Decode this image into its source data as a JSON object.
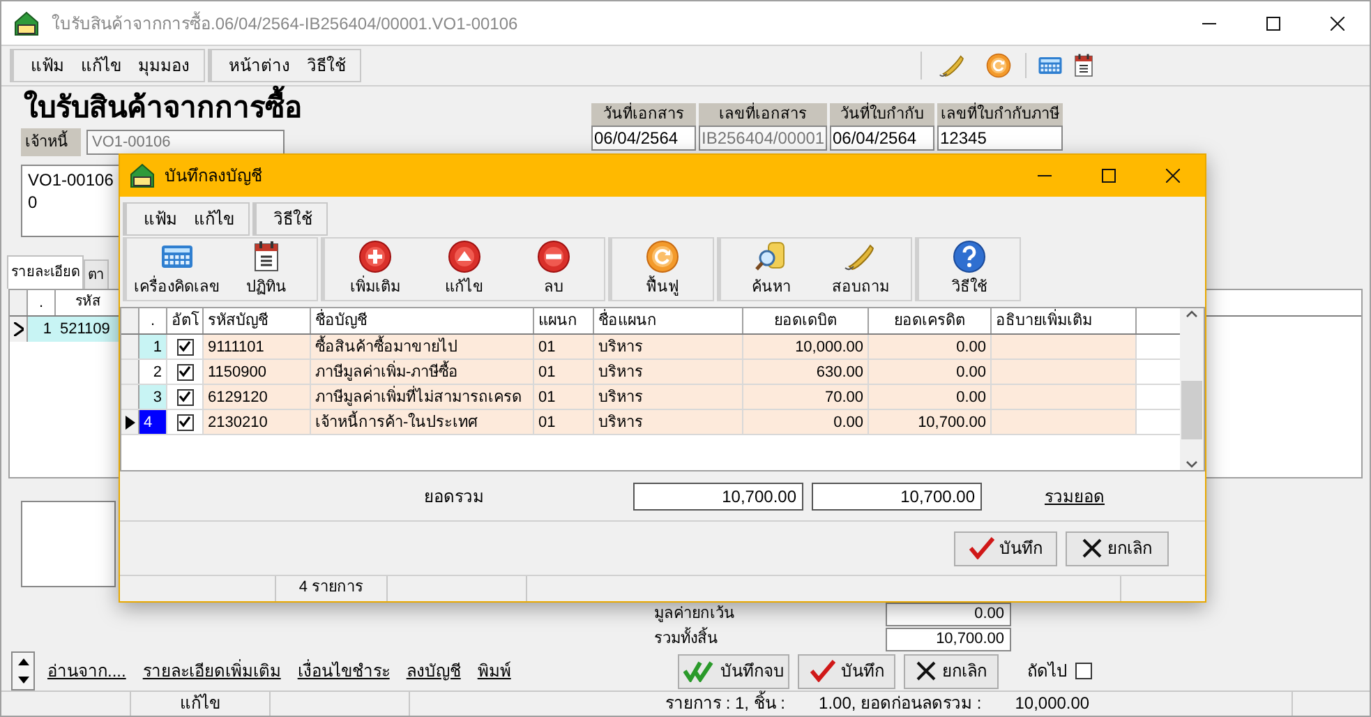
{
  "window": {
    "title": "ใบรับสินค้าจากการซื้อ.06/04/2564-IB256404/00001.VO1-00106"
  },
  "menu_groups": [
    {
      "items": [
        "แฟ้ม",
        "แก้ไข",
        "มุมมอง"
      ]
    },
    {
      "items": [
        "หน้าต่าง",
        "วิธีใช้"
      ]
    }
  ],
  "heading": "ใบรับสินค้าจากการซื้อ",
  "creditor": {
    "label": "เจ้าหนี้",
    "value": "VO1-00106",
    "disabled": true,
    "address_lines": [
      "VO1-00106",
      "0"
    ]
  },
  "document_fields": [
    {
      "label": "วันที่เอกสาร",
      "value": "06/04/2564",
      "disabled": false
    },
    {
      "label": "เลขที่เอกสาร",
      "value": "IB256404/00001",
      "disabled": true
    },
    {
      "label": "วันที่ใบกำกับ",
      "value": "06/04/2564",
      "disabled": false
    },
    {
      "label": "เลขที่ใบกำกับภาษี",
      "value": "12345",
      "disabled": false
    }
  ],
  "tabs": [
    {
      "label": "รายละเอียด",
      "selected": true
    },
    {
      "label": "ตา",
      "selected": false
    }
  ],
  "items_table": {
    "columns": [
      ".",
      "รหัส"
    ],
    "rows": [
      {
        "no": "1",
        "code": "521109",
        "selected": true
      }
    ]
  },
  "summary": [
    {
      "label": "มูลค่ายกเว้น",
      "value": "0.00"
    },
    {
      "label": "รวมทั้งสิ้น",
      "value": "10,700.00"
    }
  ],
  "links": [
    "อ่านจาก....",
    "รายละเอียดเพิ่มเติม",
    "เงื่อนไขชำระ",
    "ลงบัญชี",
    "พิมพ์"
  ],
  "buttons": [
    {
      "label": "บันทึกจบ",
      "kind": "save_close"
    },
    {
      "label": "บันทึก",
      "kind": "save"
    },
    {
      "label": "ยกเลิก",
      "kind": "cancel"
    }
  ],
  "next": {
    "label": "ถัดไป",
    "checked": false
  },
  "status_bar": {
    "mode": "แก้ไข",
    "items": "รายการ : 1, ชิ้น :",
    "quantity": "1.00, ยอดก่อนลดรวม :",
    "subtotal": "10,000.00"
  },
  "dialog": {
    "title": "บันทึกลงบัญชี",
    "menu_groups": [
      {
        "items": [
          "แฟ้ม",
          "แก้ไข"
        ]
      },
      {
        "items": [
          "วิธีใช้"
        ]
      }
    ],
    "toolbar_groups": [
      [
        {
          "label": "เครื่องคิดเลข",
          "kind": "calculator"
        },
        {
          "label": "ปฏิทิน",
          "kind": "calendar"
        }
      ],
      [
        {
          "label": "เพิ่มเติม",
          "kind": "add"
        },
        {
          "label": "แก้ไข",
          "kind": "edit"
        },
        {
          "label": "ลบ",
          "kind": "delete"
        }
      ],
      [
        {
          "label": "ฟื้นฟู",
          "kind": "refresh"
        }
      ],
      [
        {
          "label": "ค้นหา",
          "kind": "search"
        },
        {
          "label": "สอบถาม",
          "kind": "phone"
        }
      ],
      [
        {
          "label": "วิธีใช้",
          "kind": "help"
        }
      ]
    ],
    "table": {
      "columns": [
        ".",
        "อัตโ",
        "รหัสบัญชี",
        "ชื่อบัญชี",
        "แผนก",
        "ชื่อแผนก",
        "ยอดเดบิต",
        "ยอดเครดิต",
        "อธิบายเพิ่มเติม"
      ],
      "rows": [
        {
          "no": "1",
          "checked": true,
          "account": "9111101",
          "name": "ซื้อสินค้าซื้อมาขายไป",
          "dept": "01",
          "dept_name": "บริหาร",
          "debit": "10,000.00",
          "credit": "0.00",
          "selected": false
        },
        {
          "no": "2",
          "checked": true,
          "account": "1150900",
          "name": "ภาษีมูลค่าเพิ่ม-ภาษีซื้อ",
          "dept": "01",
          "dept_name": "บริหาร",
          "debit": "630.00",
          "credit": "0.00",
          "selected": false
        },
        {
          "no": "3",
          "checked": true,
          "account": "6129120",
          "name": "ภาษีมูลค่าเพิ่มที่ไม่สามารถเครด",
          "dept": "01",
          "dept_name": "บริหาร",
          "debit": "70.00",
          "credit": "0.00",
          "selected": false
        },
        {
          "no": "4",
          "checked": true,
          "account": "2130210",
          "name": "เจ้าหนี้การค้า-ในประเทศ",
          "dept": "01",
          "dept_name": "บริหาร",
          "debit": "0.00",
          "credit": "10,700.00",
          "selected": true
        }
      ]
    },
    "totals": {
      "label": "ยอดรวม",
      "debit": "10,700.00",
      "credit": "10,700.00",
      "link": "รวมยอด"
    },
    "buttons": [
      {
        "label": "บันทึก",
        "kind": "save"
      },
      {
        "label": "ยกเลิก",
        "kind": "cancel"
      }
    ],
    "status_bar": {
      "count": "4 รายการ"
    }
  }
}
